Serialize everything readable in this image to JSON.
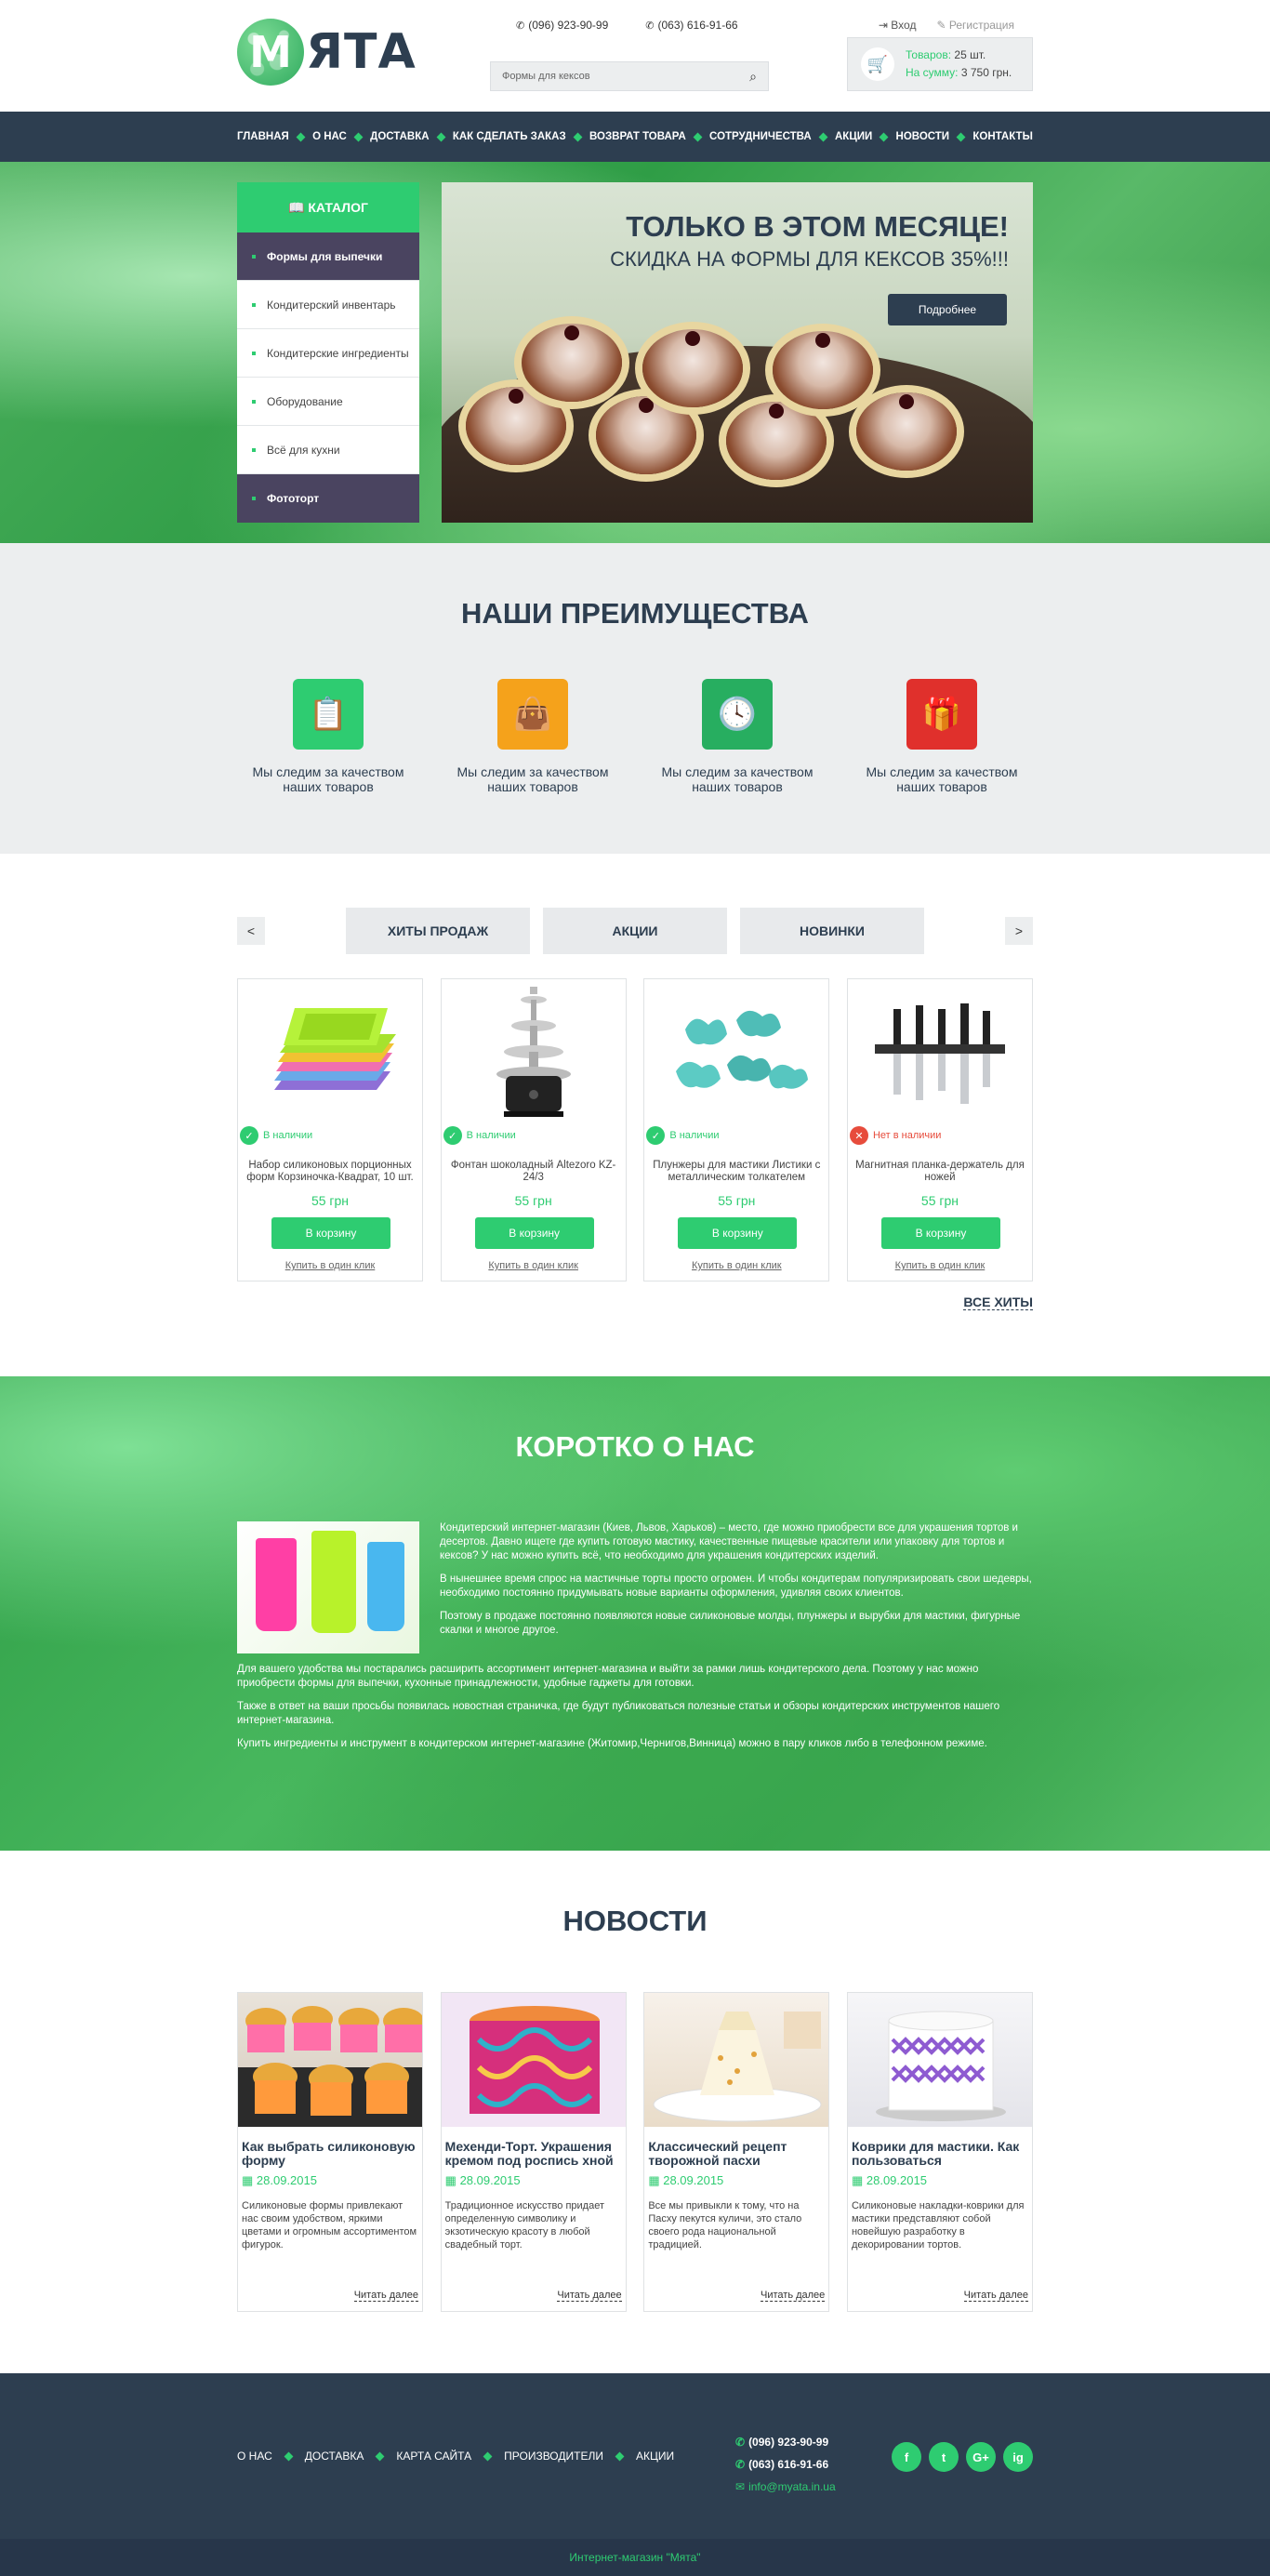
{
  "logo": {
    "letter": "М",
    "text": "ЯТА"
  },
  "header": {
    "phone1": "(096) 923-90-99",
    "phone2": "(063) 616-91-66",
    "search_placeholder": "Формы для кексов",
    "login": "Вход",
    "register": "Регистрация",
    "cart_items_label": "Товаров:",
    "cart_items_value": "25 шт.",
    "cart_sum_label": "На сумму:",
    "cart_sum_value": "3 750 грн."
  },
  "nav": [
    "ГЛАВНАЯ",
    "О НАС",
    "ДОСТАВКА",
    "КАК СДЕЛАТЬ ЗАКАЗ",
    "ВОЗВРАТ ТОВАРА",
    "СОТРУДНИЧЕСТВА",
    "АКЦИИ",
    "НОВОСТИ",
    "КОНТАКТЫ"
  ],
  "catalog": {
    "title": "КАТАЛОГ",
    "items": [
      "Формы для выпечки",
      "Кондитерский инвентарь",
      "Кондитерские ингредиенты",
      "Оборудование",
      "Всё для кухни",
      "Фототорт"
    ]
  },
  "banner": {
    "title": "ТОЛЬКО В ЭТОМ МЕСЯЦЕ!",
    "subtitle": "СКИДКА НА ФОРМЫ ДЛЯ КЕКСОВ 35%!!!",
    "button": "Подробнее"
  },
  "advantages": {
    "title": "НАШИ ПРЕИМУЩЕСТВА",
    "items": [
      {
        "text": "Мы следим за качеством наших товаров",
        "icon": "clipboard-icon",
        "color": "#2ecc71"
      },
      {
        "text": "Мы следим за качеством наших товаров",
        "icon": "shopping-bag-icon",
        "color": "#f5a21b"
      },
      {
        "text": "Мы следим за качеством наших товаров",
        "icon": "clock-icon",
        "color": "#27ae60"
      },
      {
        "text": "Мы следим за качеством наших товаров",
        "icon": "gift-icon",
        "color": "#e0302c"
      }
    ]
  },
  "products": {
    "tabs": [
      "ХИТЫ ПРОДАЖ",
      "АКЦИИ",
      "НОВИНКИ"
    ],
    "prev": "<",
    "next": ">",
    "items": [
      {
        "status": "В наличии",
        "in_stock": true,
        "name": "Набор силиконовых порционных форм Корзиночка-Квадрат, 10 шт.",
        "price": "55 грн"
      },
      {
        "status": "В наличии",
        "in_stock": true,
        "name": "Фонтан шоколадный Altezoro KZ-24/3",
        "price": "55 грн"
      },
      {
        "status": "В наличии",
        "in_stock": true,
        "name": "Плунжеры для мастики Листики с металлическим толкателем",
        "price": "55 грн"
      },
      {
        "status": "Нет в наличии",
        "in_stock": false,
        "name": "Магнитная планка-держатель для ножей",
        "price": "55 грн"
      }
    ],
    "buy_label": "В корзину",
    "one_click_label": "Купить в один клик",
    "all_link": "ВСЕ ХИТЫ"
  },
  "about": {
    "title": "КОРОТКО О НАС",
    "paragraphs": [
      "Кондитерский интернет-магазин (Киев, Львов, Харьков) – место, где можно приобрести все для украшения тортов и десертов. Давно ищете где купить готовую мастику, качественные пищевые красители или упаковку для тортов и кексов? У нас можно купить всё, что необходимо для украшения кондитерских изделий.",
      "В нынешнее время спрос на мастичные торты просто огромен. И чтобы кондитерам популяризировать свои шедевры, необходимо постоянно придумывать новые варианты оформления, удивляя своих клиентов.",
      "Поэтому в продаже постоянно появляются новые силиконовые молды, плунжеры и вырубки для мастики, фигурные скалки и многое другое.",
      "Для вашего удобства мы постарались расширить ассортимент интернет-магазина и выйти за рамки лишь кондитерского дела. Поэтому у нас можно приобрести формы для выпечки, кухонные принадлежности, удобные гаджеты для готовки.",
      "Также в ответ на ваши просьбы появилась новостная страничка, где будут публиковаться полезные статьи и обзоры кондитерских инструментов нашего интернет-магазина.",
      "Купить ингредиенты и инструмент в кондитерском интернет-магазине (Житомир,Чернигов,Винница) можно в пару кликов либо в телефонном режиме."
    ]
  },
  "news": {
    "title": "НОВОСТИ",
    "read_more": "Читать далее",
    "items": [
      {
        "title": "Как выбрать силиконовую форму",
        "date": "28.09.2015",
        "text": "Силиконовые формы привлекают нас своим удобством, яркими цветами и огромным ассортиментом фигурок."
      },
      {
        "title": "Мехенди-Торт. Украшения кремом под роспись хной",
        "date": "28.09.2015",
        "text": "Традиционное искусство придает определенную символику и экзотическую красоту в любой свадебный торт."
      },
      {
        "title": "Классический рецепт творожной пасхи",
        "date": "28.09.2015",
        "text": "Все мы привыкли к тому, что на Пасху пекутся куличи, это стало своего рода национальной традицией."
      },
      {
        "title": "Коврики для мастики. Как пользоваться",
        "date": "28.09.2015",
        "text": "Силиконовые накладки-коврики для мастики представляют собой новейшую разработку в декорировании тортов."
      }
    ]
  },
  "footer": {
    "menu": [
      "О НАС",
      "ДОСТАВКА",
      "КАРТА САЙТА",
      "ПРОИЗВОДИТЕЛИ",
      "АКЦИИ"
    ],
    "phone1": "(096) 923-90-99",
    "phone2": "(063) 616-91-66",
    "email": "info@myata.in.ua",
    "socials": [
      "f",
      "t",
      "G+",
      "ig"
    ],
    "copyright": "Интернет-магазин \"Мята\""
  }
}
